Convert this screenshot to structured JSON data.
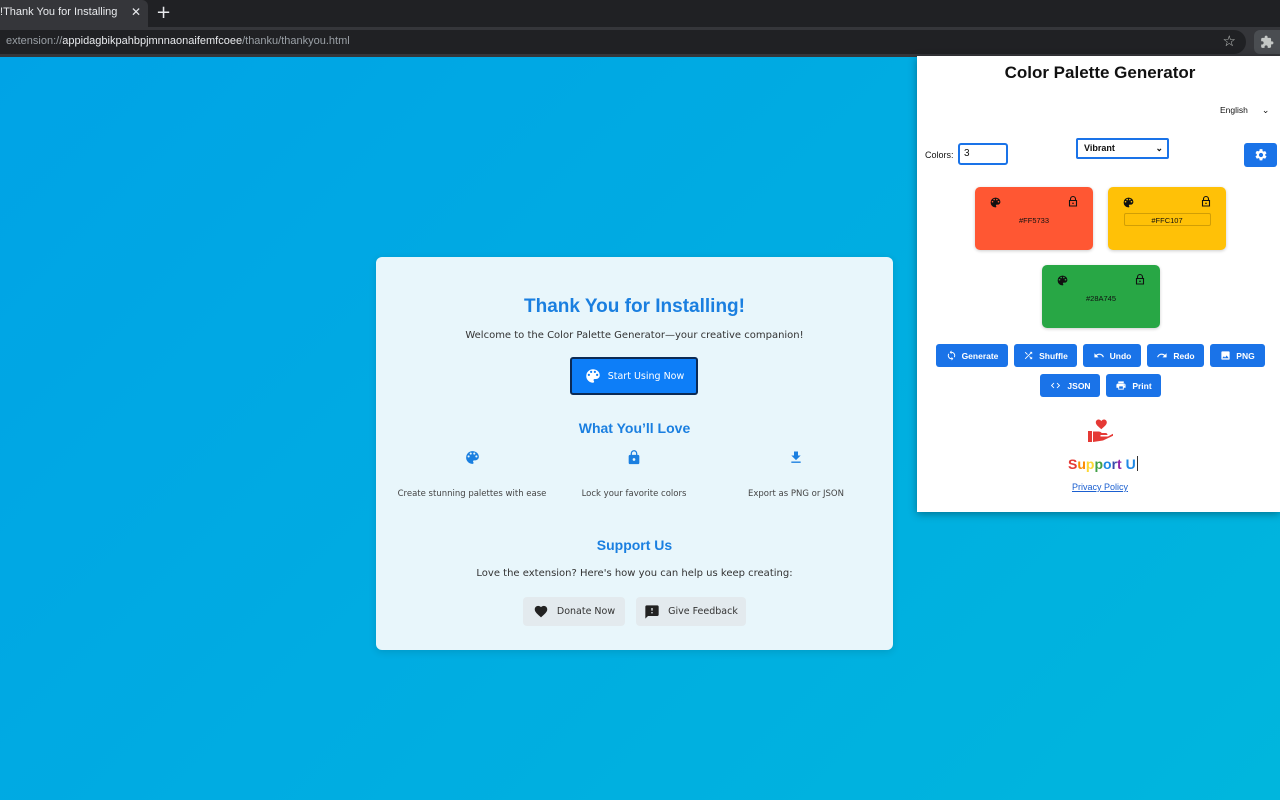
{
  "browser": {
    "tab_title": "Thank You for Installing!",
    "tab_close": "✕",
    "new_tab": "+",
    "url_scheme": "extension://",
    "url_host": "appidagbikpahbpjmnnaonaifemfcoee",
    "url_path": "/thanku/thankyou.html",
    "bookmark_icon": "star-icon",
    "extension_icon": "puzzle-icon"
  },
  "thankyou": {
    "title": "Thank You for Installing!",
    "welcome": "Welcome to the Color Palette Generator—your creative companion!",
    "start_button": "Start Using Now",
    "love_heading": "What You’ll Love",
    "features": [
      {
        "icon": "palette-icon",
        "text": "Create stunning palettes with ease"
      },
      {
        "icon": "lock-icon",
        "text": "Lock your favorite colors"
      },
      {
        "icon": "download-icon",
        "text": "Export as PNG or JSON"
      }
    ],
    "support_heading": "Support Us",
    "support_text": "Love the extension? Here's how you can help us keep creating:",
    "donate_button": "Donate Now",
    "feedback_button": "Give Feedback"
  },
  "popup": {
    "title": "Color Palette Generator",
    "language": "English",
    "colors_label": "Colors:",
    "colors_value": "3",
    "style_value": "Vibrant",
    "swatches": [
      {
        "hex": "#FF5733"
      },
      {
        "hex": "#FFC107"
      },
      {
        "hex": "#28A745"
      }
    ],
    "buttons": {
      "generate": "Generate",
      "shuffle": "Shuffle",
      "undo": "Undo",
      "redo": "Redo",
      "png": "PNG",
      "json": "JSON",
      "print": "Print"
    },
    "support_letters": [
      "S",
      "u",
      "p",
      "p",
      "o",
      "r",
      "t",
      " ",
      "U"
    ],
    "support_colors": [
      "#e53935",
      "#fb8c00",
      "#fdd835",
      "#43a047",
      "#1e88e5",
      "#3949ab",
      "#8e24aa",
      "#000000",
      "#1e88e5"
    ],
    "privacy": "Privacy Policy"
  },
  "colors": {
    "accent": "#1a73e8",
    "heading_blue": "#1a7fe0",
    "page_bg": "#00a3e6"
  }
}
